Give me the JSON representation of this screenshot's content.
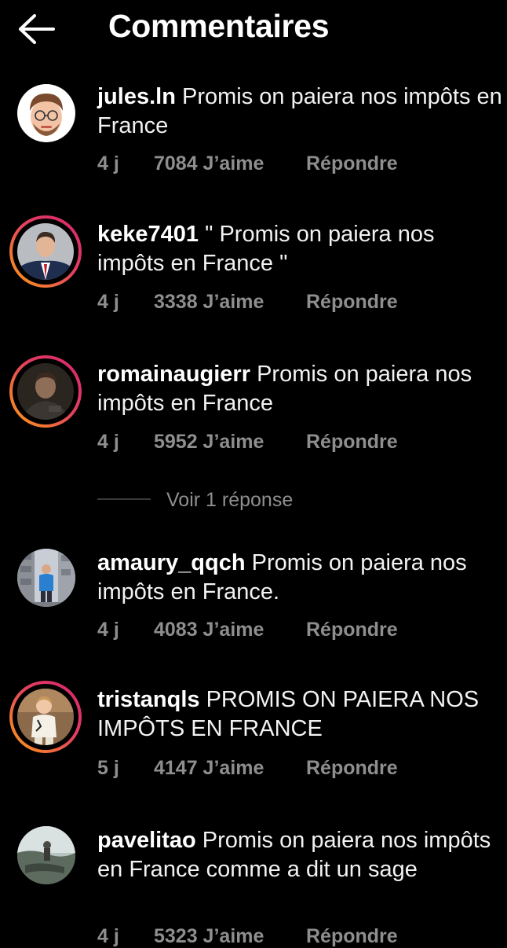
{
  "header": {
    "title": "Commentaires",
    "back_icon": "arrow-left-icon"
  },
  "colors": {
    "background": "#000000",
    "text": "#f2f2f2",
    "meta": "#8e8e8e",
    "story_ring": [
      "#d6246e",
      "#f58529"
    ]
  },
  "comments": [
    {
      "username": "jules.ln",
      "text": "Promis on paiera nos impôts en France",
      "age": "4 j",
      "likes": "7084 J’aime",
      "reply": "Répondre",
      "story_ring": false
    },
    {
      "username": "keke7401",
      "text": "\" Promis on paiera nos impôts en France \"",
      "age": "4 j",
      "likes": "3338 J’aime",
      "reply": "Répondre",
      "story_ring": true
    },
    {
      "username": "romainaugierr",
      "text": "Promis on paiera nos impôts en France",
      "age": "4 j",
      "likes": "5952 J’aime",
      "reply": "Répondre",
      "story_ring": true,
      "view_replies": "Voir 1 réponse"
    },
    {
      "username": "amaury_qqch",
      "text": "Promis on paiera nos impôts en France.",
      "age": "4 j",
      "likes": "4083 J’aime",
      "reply": "Répondre",
      "story_ring": false
    },
    {
      "username": "tristanqls",
      "text": "PROMIS ON PAIERA NOS IMPÔTS EN FRANCE",
      "age": "5 j",
      "likes": "4147 J’aime",
      "reply": "Répondre",
      "story_ring": true
    },
    {
      "username": "pavelitao",
      "text": "Promis on paiera nos impôts en France comme a dit un sage",
      "age": "4 j",
      "likes": "5323 J’aime",
      "reply": "Répondre",
      "story_ring": false
    }
  ]
}
